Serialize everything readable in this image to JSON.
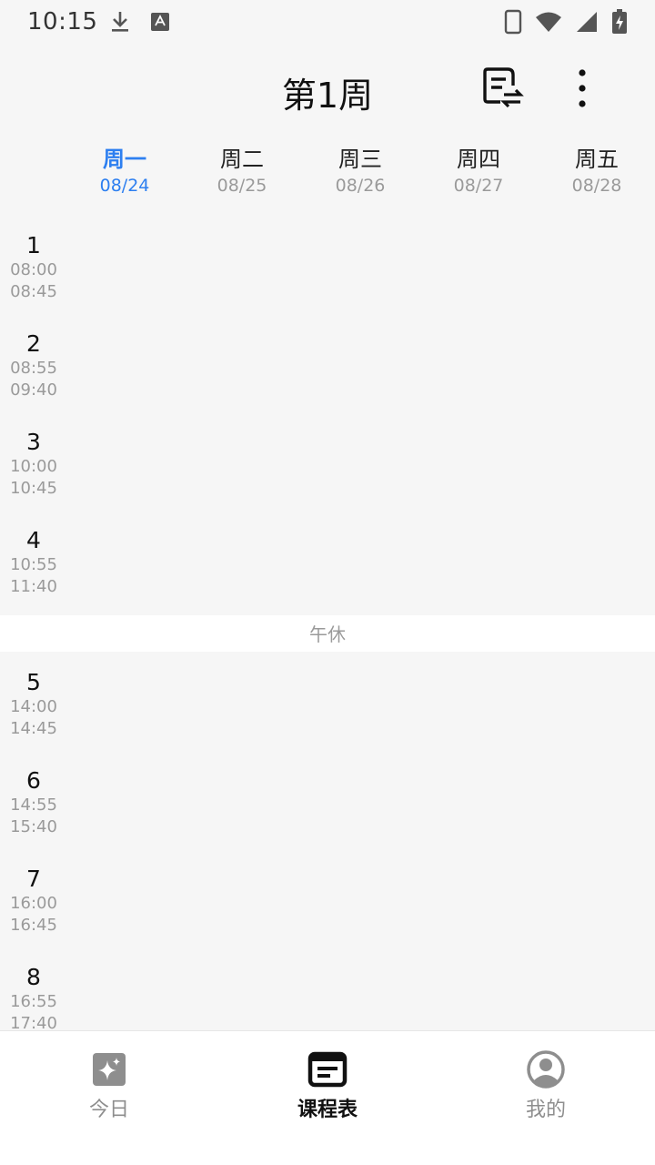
{
  "status_bar": {
    "time": "10:15",
    "icons": [
      "download-icon",
      "keyboard-a-icon",
      "phone-icon",
      "wifi-icon",
      "cellular-signal-icon",
      "battery-charging-icon"
    ]
  },
  "header": {
    "title": "第1周",
    "actions": [
      "switch-schedule-icon",
      "more-vert-icon"
    ]
  },
  "week": {
    "days": [
      {
        "name": "周一",
        "date": "08/24",
        "active": true
      },
      {
        "name": "周二",
        "date": "08/25",
        "active": false
      },
      {
        "name": "周三",
        "date": "08/26",
        "active": false
      },
      {
        "name": "周四",
        "date": "08/27",
        "active": false
      },
      {
        "name": "周五",
        "date": "08/28",
        "active": false
      }
    ]
  },
  "periods": [
    {
      "num": "1",
      "start": "08:00",
      "end": "08:45"
    },
    {
      "num": "2",
      "start": "08:55",
      "end": "09:40"
    },
    {
      "num": "3",
      "start": "10:00",
      "end": "10:45"
    },
    {
      "num": "4",
      "start": "10:55",
      "end": "11:40"
    },
    {
      "num": "5",
      "start": "14:00",
      "end": "14:45"
    },
    {
      "num": "6",
      "start": "14:55",
      "end": "15:40"
    },
    {
      "num": "7",
      "start": "16:00",
      "end": "16:45"
    },
    {
      "num": "8",
      "start": "16:55",
      "end": "17:40"
    }
  ],
  "lunch_label": "午休",
  "bottom_nav": {
    "items": [
      {
        "label": "今日",
        "icon": "sparkle-icon",
        "active": false
      },
      {
        "label": "课程表",
        "icon": "schedule-icon",
        "active": true
      },
      {
        "label": "我的",
        "icon": "profile-icon",
        "active": false
      }
    ]
  },
  "colors": {
    "accent": "#2d7ff0",
    "background": "#f6f6f6",
    "muted_text": "#9a9a9a"
  }
}
